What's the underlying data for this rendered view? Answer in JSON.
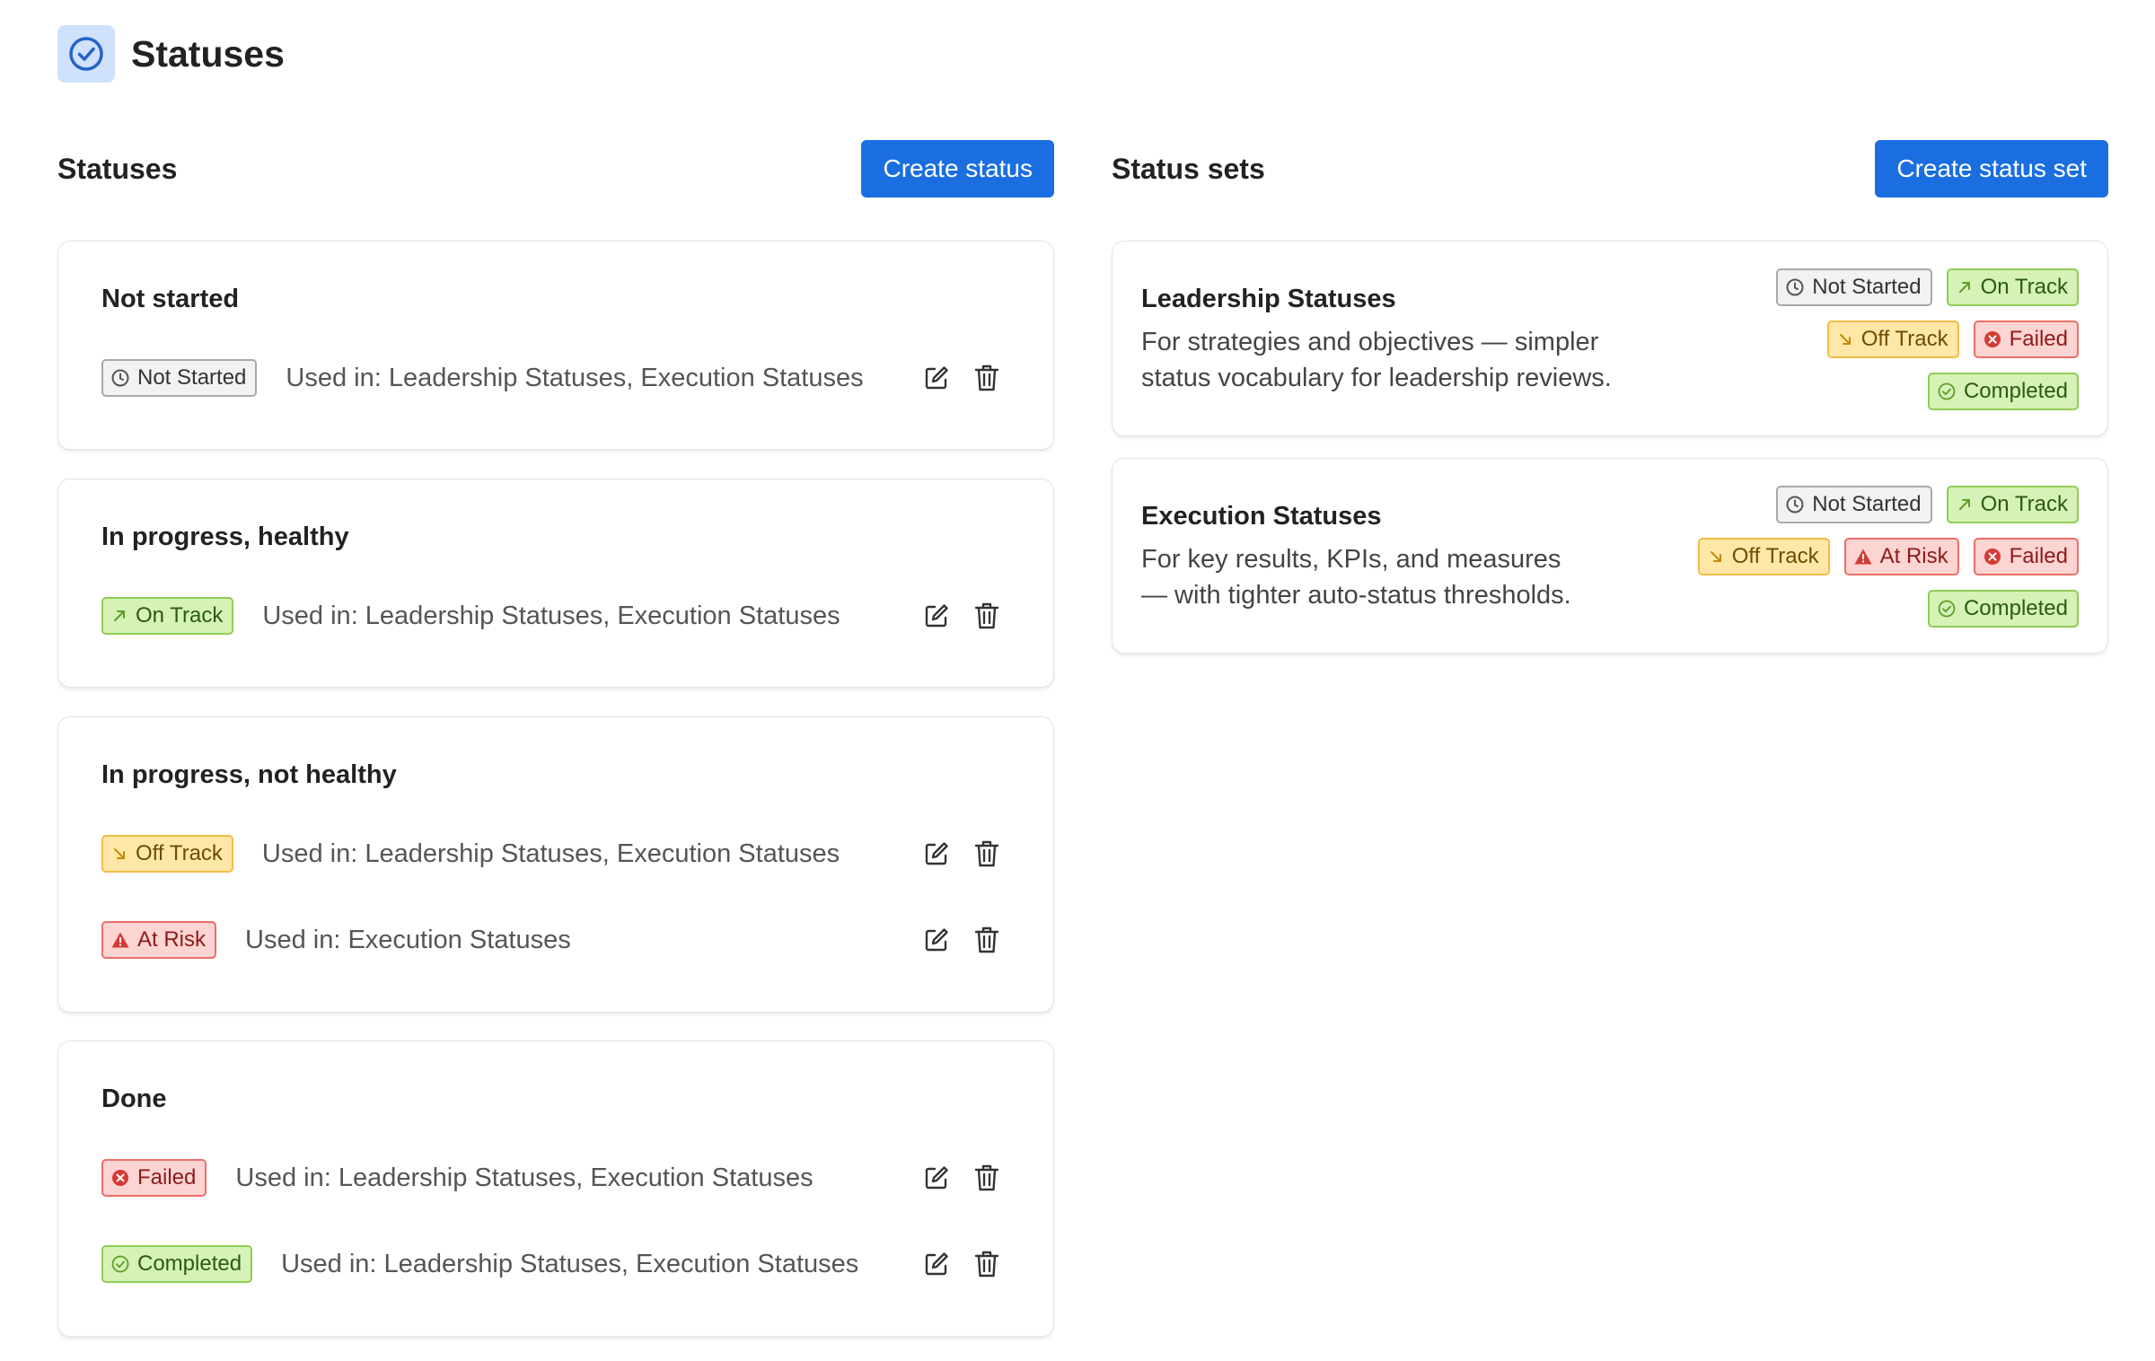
{
  "page": {
    "title": "Statuses",
    "icon": "check-circle-icon",
    "accent": "#1a6ee0"
  },
  "statuses": {
    "heading": "Statuses",
    "create_label": "Create status",
    "groups": [
      {
        "title": "Not started",
        "items": [
          {
            "label": "Not Started",
            "color": "gray",
            "icon": "clock-icon",
            "used_in": "Used in: Leadership Statuses, Execution Statuses"
          }
        ]
      },
      {
        "title": "In progress, healthy",
        "items": [
          {
            "label": "On Track",
            "color": "green",
            "icon": "arrow-up-right-icon",
            "used_in": "Used in: Leadership Statuses, Execution Statuses"
          }
        ]
      },
      {
        "title": "In progress, not healthy",
        "items": [
          {
            "label": "Off Track",
            "color": "yellow",
            "icon": "arrow-down-right-icon",
            "used_in": "Used in: Leadership Statuses, Execution Statuses"
          },
          {
            "label": "At Risk",
            "color": "red",
            "icon": "warning-icon",
            "used_in": "Used in: Execution Statuses"
          }
        ]
      },
      {
        "title": "Done",
        "items": [
          {
            "label": "Failed",
            "color": "red",
            "icon": "x-circle-icon",
            "used_in": "Used in: Leadership Statuses, Execution Statuses"
          },
          {
            "label": "Completed",
            "color": "green",
            "icon": "check-circle-icon",
            "used_in": "Used in: Leadership Statuses, Execution Statuses"
          }
        ]
      }
    ]
  },
  "status_sets": {
    "heading": "Status sets",
    "create_label": "Create status set",
    "sets": [
      {
        "title": "Leadership Statuses",
        "description_lines": [
          "For strategies and objectives — simpler",
          "status vocabulary for leadership reviews."
        ],
        "badge_rows": [
          [
            "Not Started",
            "On Track"
          ],
          [
            "Off Track",
            "Failed"
          ],
          [
            "Completed"
          ]
        ]
      },
      {
        "title": "Execution Statuses",
        "description_lines": [
          "For key results, KPIs, and measures",
          "— with tighter auto-status thresholds."
        ],
        "badge_rows": [
          [
            "Not Started",
            "On Track"
          ],
          [
            "Off Track",
            "At Risk",
            "Failed"
          ],
          [
            "Completed"
          ]
        ]
      }
    ]
  }
}
